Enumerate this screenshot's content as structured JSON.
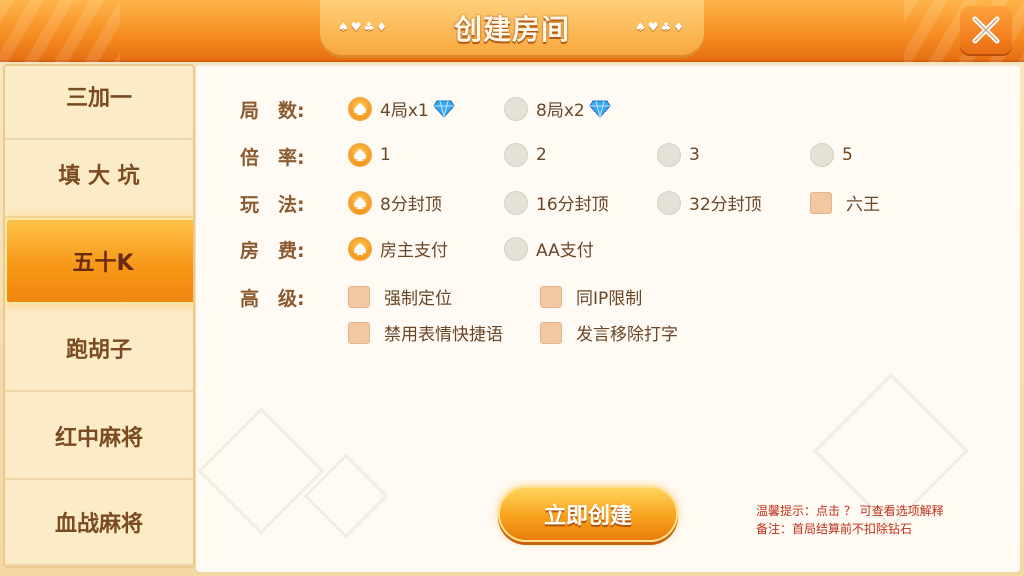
{
  "header": {
    "title": "创建房间",
    "suits_left": "♠♥♣♦",
    "suits_right": "♠♥♣♦"
  },
  "sidebar": {
    "items": [
      {
        "label": "三加一"
      },
      {
        "label": "填 大 坑"
      },
      {
        "label": "五十K",
        "active": true
      },
      {
        "label": "跑胡子"
      },
      {
        "label": "红中麻将"
      },
      {
        "label": "血战麻将"
      }
    ]
  },
  "form": {
    "rounds": {
      "label": "局　数:",
      "options": [
        {
          "label": "4局x1",
          "selected": true,
          "icon": "diamond-gem-icon"
        },
        {
          "label": "8局x2",
          "selected": false,
          "icon": "diamond-gem-icon"
        }
      ]
    },
    "rate": {
      "label": "倍　率:",
      "options": [
        {
          "label": "1",
          "selected": true
        },
        {
          "label": "2",
          "selected": false
        },
        {
          "label": "3",
          "selected": false
        },
        {
          "label": "5",
          "selected": false
        }
      ]
    },
    "play": {
      "label": "玩　法:",
      "options": [
        {
          "label": "8分封顶",
          "selected": true
        },
        {
          "label": "16分封顶",
          "selected": false
        },
        {
          "label": "32分封顶",
          "selected": false
        }
      ],
      "checkbox": {
        "label": "六王",
        "checked": false
      }
    },
    "fee": {
      "label": "房　费:",
      "options": [
        {
          "label": "房主支付",
          "selected": true
        },
        {
          "label": "AA支付",
          "selected": false
        }
      ]
    },
    "advanced": {
      "label": "高　级:",
      "checkboxes": [
        {
          "label": "强制定位",
          "checked": false
        },
        {
          "label": "同IP限制",
          "checked": false
        },
        {
          "label": "禁用表情快捷语",
          "checked": false
        },
        {
          "label": "发言移除打字",
          "checked": false
        }
      ]
    }
  },
  "create_button": {
    "label": "立即创建"
  },
  "tips": {
    "line1": "温馨提示：点击 ？ 可查看选项解释",
    "line2": "备注：首局结算前不扣除钻石"
  },
  "colors": {
    "accent": "#f59a1c",
    "header": "#f58c1f",
    "tip_text": "#c0301a"
  }
}
